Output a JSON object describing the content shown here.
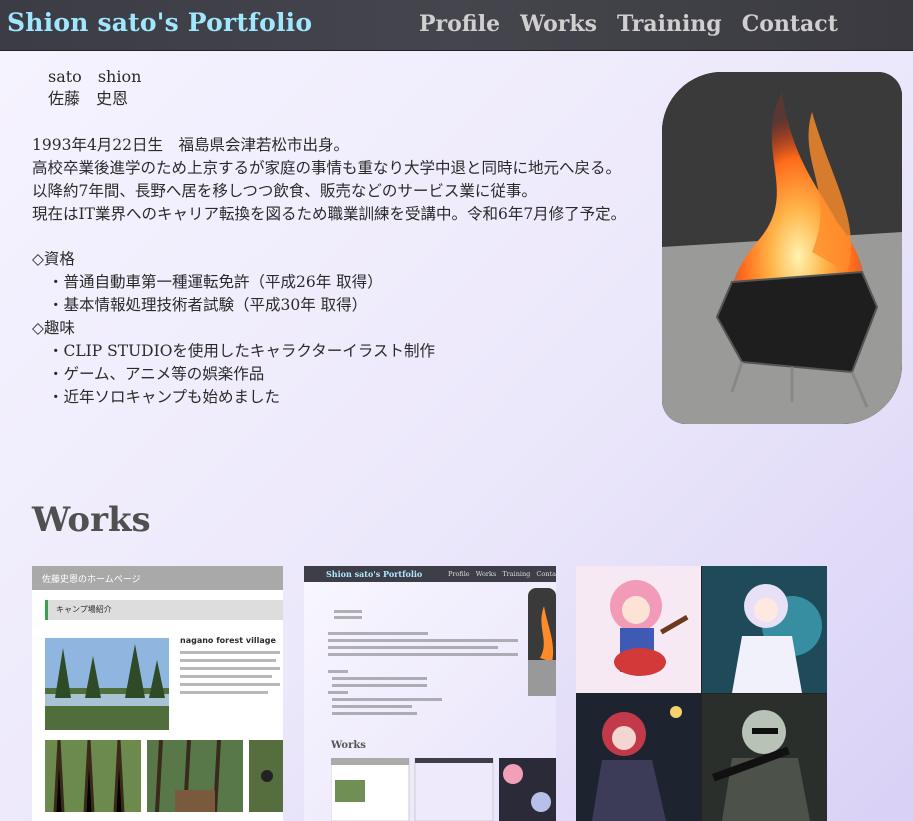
{
  "header": {
    "site_title": "Shion sato's Portfolio",
    "nav": [
      "Profile",
      "Works",
      "Training",
      "Contact"
    ]
  },
  "profile": {
    "name_romaji": "sato　shion",
    "name_kanji": "佐藤　史恩",
    "bio": [
      "1993年4月22日生　福島県会津若松市出身。",
      "高校卒業後進学のため上京するが家庭の事情も重なり大学中退と同時に地元へ戻る。",
      "以降約7年間、長野へ居を移しつつ飲食、販売などのサービス業に従事。",
      "現在はIT業界へのキャリア転換を図るため職業訓練を受講中。令和6年7月修了予定。"
    ],
    "qualifications_head": "◇資格",
    "qualifications": [
      "・普通自動車第一種運転免許（平成26年 取得）",
      "・基本情報処理技術者試験（平成30年 取得）"
    ],
    "hobbies_head": "◇趣味",
    "hobbies": [
      "・CLIP STUDIOを使用したキャラクターイラスト制作",
      "・ゲーム、アニメ等の娯楽作品",
      "・近年ソロキャンプも始めました"
    ]
  },
  "works": {
    "title": "Works",
    "thumb1": {
      "bar_text": "佐藤史恩のホームページ",
      "section": "キャンプ場紹介",
      "heading": "nagano forest village"
    },
    "thumb2": {
      "title": "Shion sato's Portfolio",
      "nav": "Profile Works Training Contact",
      "works": "Works"
    }
  },
  "colors": {
    "header_bg": "#3f3f47",
    "site_title": "#9fe6ff",
    "nav_text": "#cfcfcf",
    "page_bg": "#ece8fb"
  }
}
